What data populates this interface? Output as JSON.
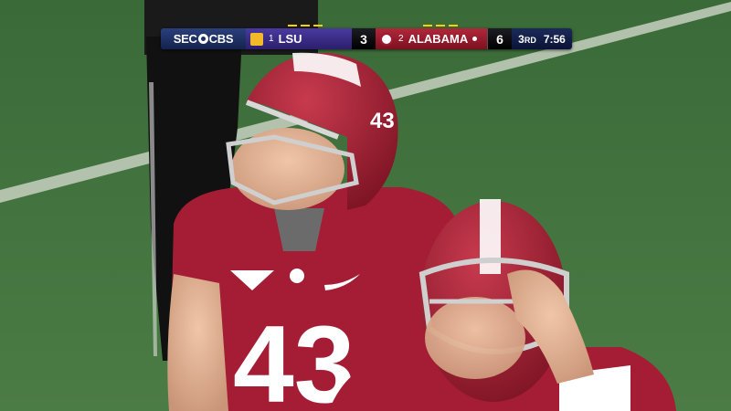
{
  "scorebug": {
    "network": "SEC",
    "network_suffix": "CBS",
    "away": {
      "rank": "1",
      "name": "LSU",
      "score": "3",
      "color": "#3d2e8c"
    },
    "home": {
      "rank": "2",
      "name": "ALABAMA",
      "score": "6",
      "color": "#9e1b32",
      "possession": true
    },
    "quarter": "3",
    "quarter_suffix": "RD",
    "clock": "7:56"
  },
  "players": {
    "front_number": "43",
    "helmet_number": "43"
  },
  "colors": {
    "field": "#3f6e3c",
    "crimson": "#9e1b32",
    "scorebug_blue": "#1b2a59"
  }
}
